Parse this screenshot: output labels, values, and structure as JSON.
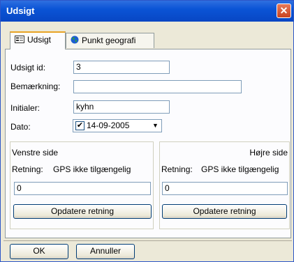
{
  "window": {
    "title": "Udsigt",
    "close_glyph": "✕"
  },
  "tabs": [
    {
      "label": "Udsigt",
      "icon": "form-icon",
      "active": true
    },
    {
      "label": "Punkt geografi",
      "icon": "globe-icon",
      "active": false
    }
  ],
  "form": {
    "id_label": "Udsigt id:",
    "id_value": "3",
    "remark_label": "Bemærkning:",
    "remark_value": "",
    "initials_label": "Initialer:",
    "initials_value": "kyhn",
    "date_label": "Dato:",
    "date_value": "14-09-2005",
    "date_checked": true
  },
  "left_side": {
    "title": "Venstre side",
    "direction_label": "Retning:",
    "direction_status": "GPS ikke tilgængelig",
    "value": "0",
    "update_button": "Opdatere retning"
  },
  "right_side": {
    "title": "Højre side",
    "direction_label": "Retning:",
    "direction_status": "GPS ikke tilgængelig",
    "value": "0",
    "update_button": "Opdatere retning"
  },
  "buttons": {
    "ok": "OK",
    "cancel": "Annuller"
  },
  "colors": {
    "titlebar": "#0a54d6",
    "close": "#c8431f",
    "tab_highlight": "#e8a325",
    "window_bg": "#ece9d8"
  }
}
